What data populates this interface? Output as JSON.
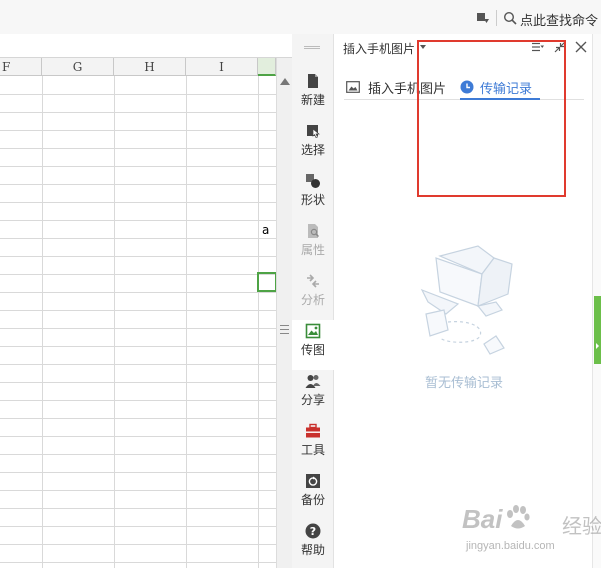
{
  "topbar": {
    "search_label": "点此查找命令"
  },
  "sheet": {
    "columns": [
      "F",
      "G",
      "H",
      "I"
    ],
    "cell_text": "a"
  },
  "sidebar": {
    "items": [
      {
        "label": "新建",
        "icon": "new-document-icon"
      },
      {
        "label": "选择",
        "icon": "select-cursor-icon"
      },
      {
        "label": "形状",
        "icon": "shapes-icon"
      },
      {
        "label": "属性",
        "icon": "properties-icon"
      },
      {
        "label": "分析",
        "icon": "analysis-icon"
      },
      {
        "label": "传图",
        "icon": "photo-transfer-icon"
      },
      {
        "label": "分享",
        "icon": "share-people-icon"
      },
      {
        "label": "工具",
        "icon": "toolbox-icon"
      },
      {
        "label": "备份",
        "icon": "backup-icon"
      },
      {
        "label": "帮助",
        "icon": "help-icon"
      }
    ],
    "active_item": "传图"
  },
  "panel": {
    "title": "插入手机图片",
    "tabs": [
      {
        "label": "插入手机图片",
        "icon": "image-insert-icon"
      },
      {
        "label": "传输记录",
        "icon": "clock-icon"
      }
    ],
    "active_tab": "传输记录",
    "empty_text": "暂无传输记录"
  },
  "watermark": {
    "logo": "Bai",
    "logo_tail": "经验",
    "url": "jingyan.baidu.com"
  },
  "colors": {
    "accent_blue": "#3e7bd6",
    "select_green": "#4ea345",
    "annotation_red": "#e03a2e",
    "empty_text": "#a9bed3"
  }
}
